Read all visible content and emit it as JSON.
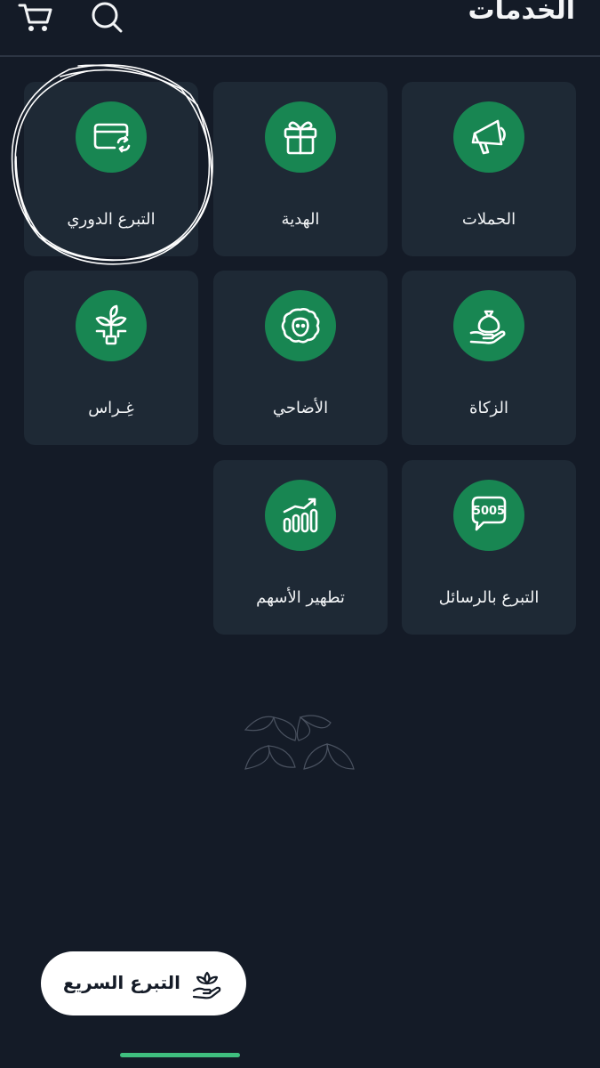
{
  "header": {
    "title": "الخدمات",
    "search_icon": "search-icon",
    "cart_icon": "cart-icon"
  },
  "services": [
    {
      "label": "الحملات",
      "icon": "megaphone-icon"
    },
    {
      "label": "الهدية",
      "icon": "gift-icon"
    },
    {
      "label": "التبرع الدوري",
      "icon": "card-repeat-icon"
    },
    {
      "label": "الزكاة",
      "icon": "money-bag-hand-icon"
    },
    {
      "label": "الأضاحي",
      "icon": "sheep-icon"
    },
    {
      "label": "غِـراس",
      "icon": "plant-icon"
    },
    {
      "label": "التبرع بالرسائل",
      "icon": "sms-5005-icon",
      "sms_number": "5005"
    },
    {
      "label": "تطهير الأسهم",
      "icon": "bar-chart-icon"
    }
  ],
  "quick_donate": {
    "label": "التبرع السريع",
    "icon": "hand-leaf-icon"
  },
  "colors": {
    "background": "#141b27",
    "card": "#1e2935",
    "accent": "#188652",
    "fab": "#ffffff",
    "home_indicator": "#3fbf7f"
  }
}
